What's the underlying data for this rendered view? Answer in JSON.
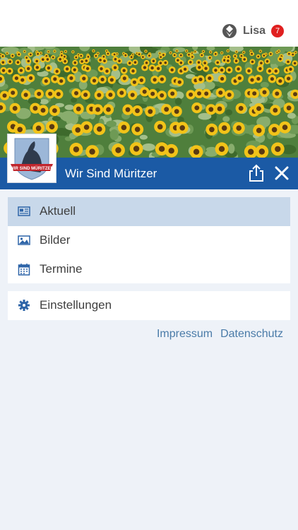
{
  "header": {
    "user_name": "Lisa",
    "notification_count": "7"
  },
  "group": {
    "name": "Wir Sind Müritzer",
    "logo_text": "WIR SIND MÜRITZER"
  },
  "menu": {
    "primary": [
      {
        "label": "Aktuell",
        "icon": "newspaper-icon",
        "active": true
      },
      {
        "label": "Bilder",
        "icon": "image-icon",
        "active": false
      },
      {
        "label": "Termine",
        "icon": "calendar-icon",
        "active": false
      }
    ],
    "secondary": [
      {
        "label": "Einstellungen",
        "icon": "gear-icon",
        "active": false
      }
    ]
  },
  "footer_links": {
    "impressum": "Impressum",
    "datenschutz": "Datenschutz"
  },
  "colors": {
    "brand_blue": "#1b5aa5",
    "active_item": "#c8d8ea",
    "link": "#4a7ba8",
    "badge": "#e02020"
  }
}
